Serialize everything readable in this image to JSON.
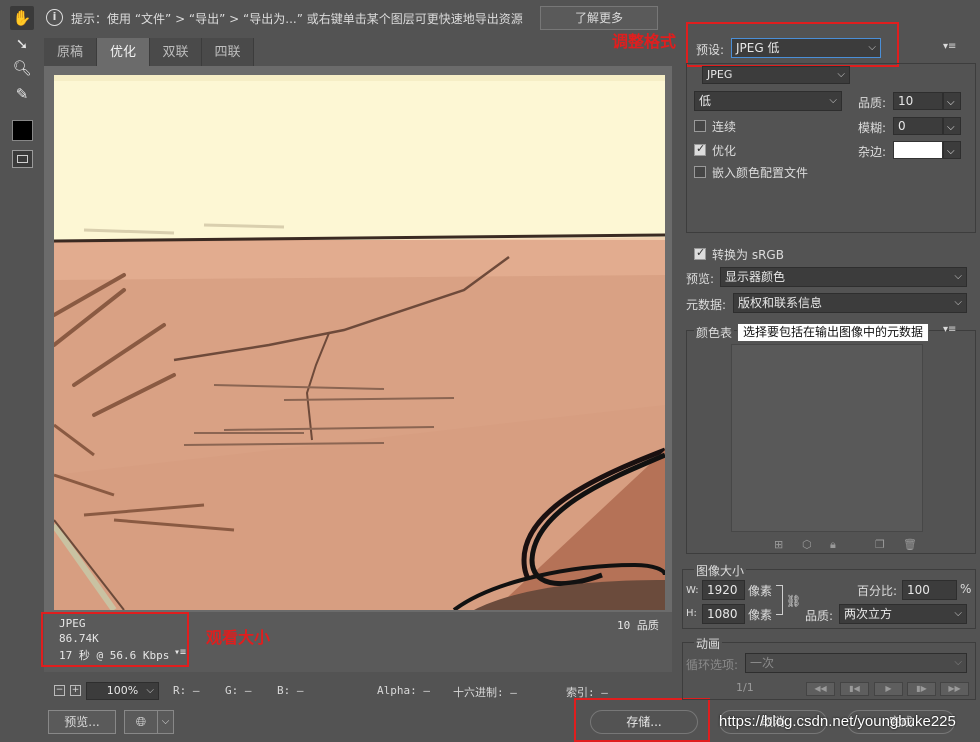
{
  "toolbar": {
    "tools": [
      "hand-tool",
      "slice-select-tool",
      "zoom-tool",
      "eyedropper-tool",
      "eyedropper-color",
      "toggle-slices-visibility"
    ]
  },
  "hint": {
    "text": "提示：使用 “文件” > “导出” > “导出为...” 或右键单击某个图层可更快速地导出资源",
    "learn_more": "了解更多"
  },
  "tabs": [
    "原稿",
    "优化",
    "双联",
    "四联"
  ],
  "info": {
    "format": "JPEG",
    "size": "86.74K",
    "time": "17 秒 @ 56.6 Kbps",
    "quality": "10 品质"
  },
  "annotations": {
    "adjust_format": "调整格式",
    "view_size": "观看大小"
  },
  "zoom": {
    "value": "100%",
    "minus": "−",
    "plus": "+"
  },
  "statusbar": {
    "r": "R: —",
    "g": "G: —",
    "b": "B: —",
    "alpha": "Alpha: —",
    "hex": "十六进制: —",
    "index": "索引: —"
  },
  "settings": {
    "preset_label": "预设:",
    "preset_value": "JPEG 低",
    "format_value": "JPEG",
    "quality_level": "低",
    "quality_label": "品质:",
    "quality_value": "10",
    "progressive_label": "连续",
    "blur_label": "模糊:",
    "blur_value": "0",
    "optimized_label": "优化",
    "matte_label": "杂边:",
    "embed_profile_label": "嵌入颜色配置文件",
    "convert_srgb_label": "转换为 sRGB",
    "preview_label": "预览:",
    "preview_value": "显示器颜色",
    "metadata_label": "元数据:",
    "metadata_value": "版权和联系信息",
    "color_table_label": "颜色表",
    "tooltip": "选择要包括在输出图像中的元数据"
  },
  "image_size": {
    "title": "图像大小",
    "w_label": "W:",
    "w_value": "1920",
    "h_label": "H:",
    "h_value": "1080",
    "unit": "像素",
    "percent_label": "百分比:",
    "percent_value": "100",
    "percent_unit": "%",
    "quality_label": "品质:",
    "quality_value": "两次立方"
  },
  "animation": {
    "title": "动画",
    "loop_label": "循环选项:",
    "loop_value": "一次",
    "frame": "1/1"
  },
  "buttons": {
    "preview": "预览...",
    "save": "存储...",
    "cancel": "取消",
    "done": "完成"
  },
  "watermark": "https://blog.csdn.net/youngbuke225"
}
